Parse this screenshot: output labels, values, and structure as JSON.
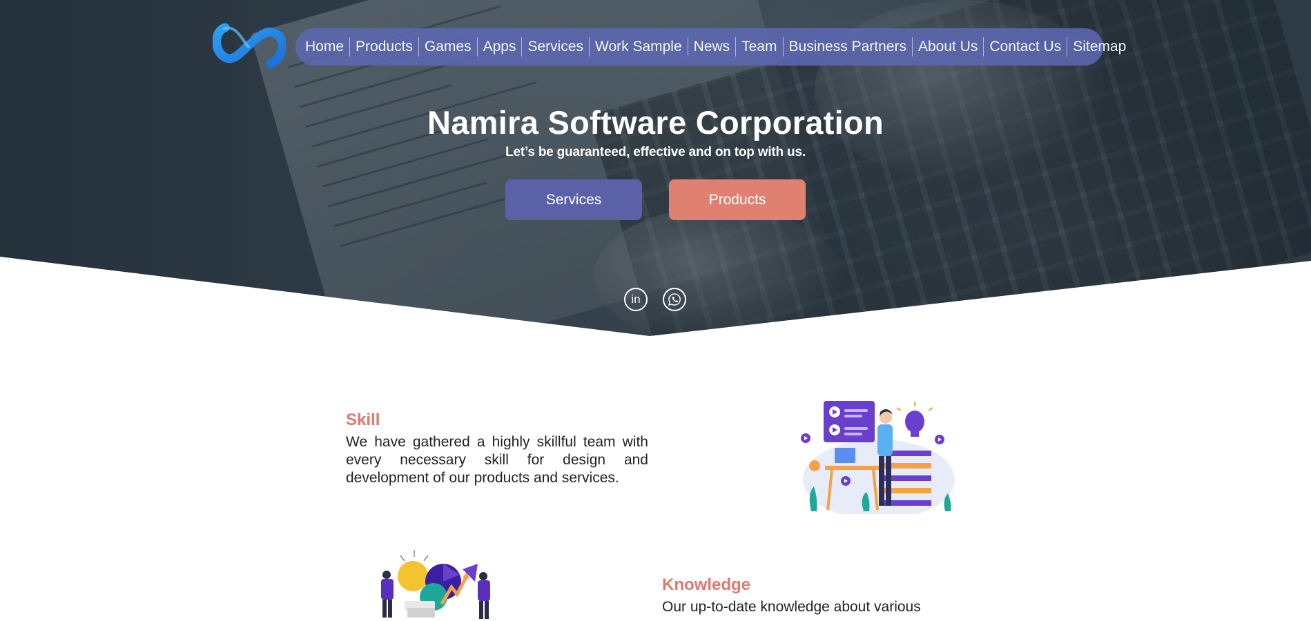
{
  "nav": {
    "items": [
      "Home",
      "Products",
      "Games",
      "Apps",
      "Services",
      "Work Sample",
      "News",
      "Team",
      "Business Partners",
      "About Us",
      "Contact Us",
      "Sitemap"
    ]
  },
  "hero": {
    "title": "Namira Software Corporation",
    "subtitle": "Let’s be guaranteed, effective and on top with us.",
    "buttons": {
      "services": "Services",
      "products": "Products"
    }
  },
  "social": {
    "linkedin": "in",
    "whatsapp_icon": "whatsapp-icon"
  },
  "features": {
    "skill": {
      "title": "Skill",
      "text": "We have gathered a highly skillful team with every necessary skill for design and development of our products and services."
    },
    "knowledge": {
      "title": "Knowledge",
      "text": "Our up-to-date knowledge about various"
    }
  },
  "colors": {
    "nav_bg": "#5c68b0",
    "services_button": "#5b61a6",
    "products_button": "#e08070",
    "accent_title": "#e0796d"
  }
}
